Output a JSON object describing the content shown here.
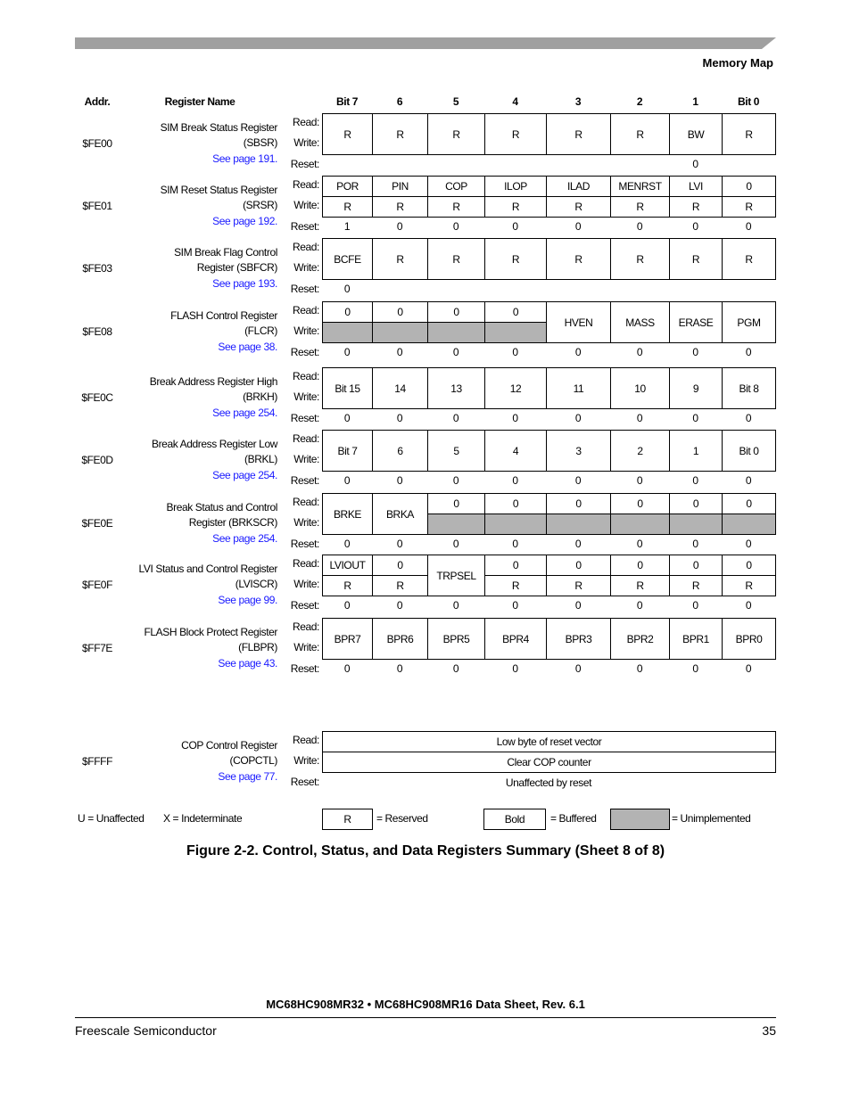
{
  "header": {
    "section": "Memory Map"
  },
  "columns": {
    "addr": "Addr.",
    "name": "Register Name",
    "bits": [
      "Bit 7",
      "6",
      "5",
      "4",
      "3",
      "2",
      "1",
      "Bit 0"
    ]
  },
  "row_labels": {
    "read": "Read:",
    "write": "Write:",
    "reset": "Reset:"
  },
  "registers": [
    {
      "addr": "$FE00",
      "name_lines": [
        "SIM Break Status Register",
        "(SBSR)"
      ],
      "link": "See page 191.",
      "cells": [
        {
          "t": "R",
          "c": [
            0,
            0
          ],
          "r": "rw"
        },
        {
          "t": "R",
          "c": [
            1,
            1
          ],
          "r": "rw"
        },
        {
          "t": "R",
          "c": [
            2,
            2
          ],
          "r": "rw"
        },
        {
          "t": "R",
          "c": [
            3,
            3
          ],
          "r": "rw"
        },
        {
          "t": "R",
          "c": [
            4,
            4
          ],
          "r": "rw"
        },
        {
          "t": "R",
          "c": [
            5,
            5
          ],
          "r": "rw"
        },
        {
          "t": "BW",
          "c": [
            6,
            6
          ],
          "r": "rw"
        },
        {
          "t": "R",
          "c": [
            7,
            7
          ],
          "r": "rw"
        }
      ],
      "reset": [
        "",
        "",
        "",
        "",
        "",
        "",
        "0",
        ""
      ]
    },
    {
      "addr": "$FE01",
      "name_lines": [
        "SIM Reset Status Register",
        "(SRSR)"
      ],
      "link": "See page 192.",
      "cells": [
        {
          "t": "POR",
          "c": [
            0,
            0
          ],
          "r": "r"
        },
        {
          "t": "PIN",
          "c": [
            1,
            1
          ],
          "r": "r"
        },
        {
          "t": "COP",
          "c": [
            2,
            2
          ],
          "r": "r"
        },
        {
          "t": "ILOP",
          "c": [
            3,
            3
          ],
          "r": "r"
        },
        {
          "t": "ILAD",
          "c": [
            4,
            4
          ],
          "r": "r"
        },
        {
          "t": "MENRST",
          "c": [
            5,
            5
          ],
          "r": "r"
        },
        {
          "t": "LVI",
          "c": [
            6,
            6
          ],
          "r": "r"
        },
        {
          "t": "0",
          "c": [
            7,
            7
          ],
          "r": "r"
        },
        {
          "t": "R",
          "c": [
            0,
            0
          ],
          "r": "w"
        },
        {
          "t": "R",
          "c": [
            1,
            1
          ],
          "r": "w"
        },
        {
          "t": "R",
          "c": [
            2,
            2
          ],
          "r": "w"
        },
        {
          "t": "R",
          "c": [
            3,
            3
          ],
          "r": "w"
        },
        {
          "t": "R",
          "c": [
            4,
            4
          ],
          "r": "w"
        },
        {
          "t": "R",
          "c": [
            5,
            5
          ],
          "r": "w"
        },
        {
          "t": "R",
          "c": [
            6,
            6
          ],
          "r": "w"
        },
        {
          "t": "R",
          "c": [
            7,
            7
          ],
          "r": "w"
        }
      ],
      "reset": [
        "1",
        "0",
        "0",
        "0",
        "0",
        "0",
        "0",
        "0"
      ]
    },
    {
      "addr": "$FE03",
      "name_lines": [
        "SIM Break Flag Control",
        "Register (SBFCR)"
      ],
      "link": "See page 193.",
      "cells": [
        {
          "t": "BCFE",
          "c": [
            0,
            0
          ],
          "r": "rw"
        },
        {
          "t": "R",
          "c": [
            1,
            1
          ],
          "r": "rw"
        },
        {
          "t": "R",
          "c": [
            2,
            2
          ],
          "r": "rw"
        },
        {
          "t": "R",
          "c": [
            3,
            3
          ],
          "r": "rw"
        },
        {
          "t": "R",
          "c": [
            4,
            4
          ],
          "r": "rw"
        },
        {
          "t": "R",
          "c": [
            5,
            5
          ],
          "r": "rw"
        },
        {
          "t": "R",
          "c": [
            6,
            6
          ],
          "r": "rw"
        },
        {
          "t": "R",
          "c": [
            7,
            7
          ],
          "r": "rw"
        }
      ],
      "reset": [
        "0",
        "",
        "",
        "",
        "",
        "",
        "",
        ""
      ]
    },
    {
      "addr": "$FE08",
      "name_lines": [
        "FLASH Control Register",
        "(FLCR)"
      ],
      "link": "See page 38.",
      "cells": [
        {
          "t": "0",
          "c": [
            0,
            0
          ],
          "r": "r"
        },
        {
          "t": "0",
          "c": [
            1,
            1
          ],
          "r": "r"
        },
        {
          "t": "0",
          "c": [
            2,
            2
          ],
          "r": "r"
        },
        {
          "t": "0",
          "c": [
            3,
            3
          ],
          "r": "r"
        },
        {
          "t": "",
          "c": [
            0,
            0
          ],
          "r": "w",
          "unimplemented": true
        },
        {
          "t": "",
          "c": [
            1,
            1
          ],
          "r": "w",
          "unimplemented": true
        },
        {
          "t": "",
          "c": [
            2,
            2
          ],
          "r": "w",
          "unimplemented": true
        },
        {
          "t": "",
          "c": [
            3,
            3
          ],
          "r": "w",
          "unimplemented": true
        },
        {
          "t": "HVEN",
          "c": [
            4,
            4
          ],
          "r": "rw"
        },
        {
          "t": "MASS",
          "c": [
            5,
            5
          ],
          "r": "rw"
        },
        {
          "t": "ERASE",
          "c": [
            6,
            6
          ],
          "r": "rw"
        },
        {
          "t": "PGM",
          "c": [
            7,
            7
          ],
          "r": "rw"
        }
      ],
      "reset": [
        "0",
        "0",
        "0",
        "0",
        "0",
        "0",
        "0",
        "0"
      ]
    },
    {
      "addr": "$FE0C",
      "name_lines": [
        "Break Address Register High",
        "(BRKH)"
      ],
      "link": "See page 254.",
      "cells": [
        {
          "t": "Bit 15",
          "c": [
            0,
            0
          ],
          "r": "rw"
        },
        {
          "t": "14",
          "c": [
            1,
            1
          ],
          "r": "rw"
        },
        {
          "t": "13",
          "c": [
            2,
            2
          ],
          "r": "rw"
        },
        {
          "t": "12",
          "c": [
            3,
            3
          ],
          "r": "rw"
        },
        {
          "t": "11",
          "c": [
            4,
            4
          ],
          "r": "rw"
        },
        {
          "t": "10",
          "c": [
            5,
            5
          ],
          "r": "rw"
        },
        {
          "t": "9",
          "c": [
            6,
            6
          ],
          "r": "rw"
        },
        {
          "t": "Bit 8",
          "c": [
            7,
            7
          ],
          "r": "rw"
        }
      ],
      "reset": [
        "0",
        "0",
        "0",
        "0",
        "0",
        "0",
        "0",
        "0"
      ]
    },
    {
      "addr": "$FE0D",
      "name_lines": [
        "Break Address Register Low",
        "(BRKL)"
      ],
      "link": "See page 254.",
      "cells": [
        {
          "t": "Bit 7",
          "c": [
            0,
            0
          ],
          "r": "rw"
        },
        {
          "t": "6",
          "c": [
            1,
            1
          ],
          "r": "rw"
        },
        {
          "t": "5",
          "c": [
            2,
            2
          ],
          "r": "rw"
        },
        {
          "t": "4",
          "c": [
            3,
            3
          ],
          "r": "rw"
        },
        {
          "t": "3",
          "c": [
            4,
            4
          ],
          "r": "rw"
        },
        {
          "t": "2",
          "c": [
            5,
            5
          ],
          "r": "rw"
        },
        {
          "t": "1",
          "c": [
            6,
            6
          ],
          "r": "rw"
        },
        {
          "t": "Bit 0",
          "c": [
            7,
            7
          ],
          "r": "rw"
        }
      ],
      "reset": [
        "0",
        "0",
        "0",
        "0",
        "0",
        "0",
        "0",
        "0"
      ]
    },
    {
      "addr": "$FE0E",
      "name_lines": [
        "Break Status and Control",
        "Register (BRKSCR)"
      ],
      "link": "See page 254.",
      "cells": [
        {
          "t": "BRKE",
          "c": [
            0,
            0
          ],
          "r": "rw"
        },
        {
          "t": "BRKA",
          "c": [
            1,
            1
          ],
          "r": "rw"
        },
        {
          "t": "0",
          "c": [
            2,
            2
          ],
          "r": "r"
        },
        {
          "t": "0",
          "c": [
            3,
            3
          ],
          "r": "r"
        },
        {
          "t": "0",
          "c": [
            4,
            4
          ],
          "r": "r"
        },
        {
          "t": "0",
          "c": [
            5,
            5
          ],
          "r": "r"
        },
        {
          "t": "0",
          "c": [
            6,
            6
          ],
          "r": "r"
        },
        {
          "t": "0",
          "c": [
            7,
            7
          ],
          "r": "r"
        },
        {
          "t": "",
          "c": [
            2,
            2
          ],
          "r": "w",
          "unimplemented": true
        },
        {
          "t": "",
          "c": [
            3,
            3
          ],
          "r": "w",
          "unimplemented": true
        },
        {
          "t": "",
          "c": [
            4,
            4
          ],
          "r": "w",
          "unimplemented": true
        },
        {
          "t": "",
          "c": [
            5,
            5
          ],
          "r": "w",
          "unimplemented": true
        },
        {
          "t": "",
          "c": [
            6,
            6
          ],
          "r": "w",
          "unimplemented": true
        },
        {
          "t": "",
          "c": [
            7,
            7
          ],
          "r": "w",
          "unimplemented": true
        }
      ],
      "reset": [
        "0",
        "0",
        "0",
        "0",
        "0",
        "0",
        "0",
        "0"
      ]
    },
    {
      "addr": "$FE0F",
      "name_lines": [
        "LVI Status and Control Register",
        "(LVISCR)"
      ],
      "link": "See page 99.",
      "cells": [
        {
          "t": "LVIOUT",
          "c": [
            0,
            0
          ],
          "r": "r"
        },
        {
          "t": "0",
          "c": [
            1,
            1
          ],
          "r": "r"
        },
        {
          "t": "R",
          "c": [
            0,
            0
          ],
          "r": "w"
        },
        {
          "t": "R",
          "c": [
            1,
            1
          ],
          "r": "w"
        },
        {
          "t": "TRPSEL",
          "c": [
            2,
            2
          ],
          "r": "rw"
        },
        {
          "t": "0",
          "c": [
            3,
            3
          ],
          "r": "r"
        },
        {
          "t": "0",
          "c": [
            4,
            4
          ],
          "r": "r"
        },
        {
          "t": "0",
          "c": [
            5,
            5
          ],
          "r": "r"
        },
        {
          "t": "0",
          "c": [
            6,
            6
          ],
          "r": "r"
        },
        {
          "t": "0",
          "c": [
            7,
            7
          ],
          "r": "r"
        },
        {
          "t": "R",
          "c": [
            3,
            3
          ],
          "r": "w"
        },
        {
          "t": "R",
          "c": [
            4,
            4
          ],
          "r": "w"
        },
        {
          "t": "R",
          "c": [
            5,
            5
          ],
          "r": "w"
        },
        {
          "t": "R",
          "c": [
            6,
            6
          ],
          "r": "w"
        },
        {
          "t": "R",
          "c": [
            7,
            7
          ],
          "r": "w"
        }
      ],
      "reset": [
        "0",
        "0",
        "0",
        "0",
        "0",
        "0",
        "0",
        "0"
      ]
    },
    {
      "addr": "$FF7E",
      "name_lines": [
        "FLASH Block Protect Register",
        "(FLBPR)"
      ],
      "link": "See page 43.",
      "cells": [
        {
          "t": "BPR7",
          "c": [
            0,
            0
          ],
          "r": "rw"
        },
        {
          "t": "BPR6",
          "c": [
            1,
            1
          ],
          "r": "rw"
        },
        {
          "t": "BPR5",
          "c": [
            2,
            2
          ],
          "r": "rw"
        },
        {
          "t": "BPR4",
          "c": [
            3,
            3
          ],
          "r": "rw"
        },
        {
          "t": "BPR3",
          "c": [
            4,
            4
          ],
          "r": "rw"
        },
        {
          "t": "BPR2",
          "c": [
            5,
            5
          ],
          "r": "rw"
        },
        {
          "t": "BPR1",
          "c": [
            6,
            6
          ],
          "r": "rw"
        },
        {
          "t": "BPR0",
          "c": [
            7,
            7
          ],
          "r": "rw"
        }
      ],
      "reset": [
        "0",
        "0",
        "0",
        "0",
        "0",
        "0",
        "0",
        "0"
      ]
    },
    {
      "addr": "$FFFF",
      "name_lines": [
        "COP Control Register",
        "(COPCTL)"
      ],
      "link": "See page 77.",
      "cells": [
        {
          "t": "Low byte of reset vector",
          "c": [
            0,
            7
          ],
          "r": "r"
        },
        {
          "t": "Clear COP counter",
          "c": [
            0,
            7
          ],
          "r": "w"
        }
      ],
      "reset_text": "Unaffected by reset"
    }
  ],
  "legend": {
    "unaffected": "U = Unaffected",
    "indeterminate": "X = Indeterminate",
    "reserved_box": "R",
    "reserved": "= Reserved",
    "bold_box": "Bold",
    "buffered": "= Buffered",
    "unimplemented": "= Unimplemented",
    "unimplemented_color": "#b3b3b3"
  },
  "caption": "Figure 2-2. Control, Status, and Data Registers Summary  (Sheet 8 of 8)",
  "footer": {
    "doc_title": "MC68HC908MR32 • MC68HC908MR16 Data Sheet, Rev. 6.1",
    "company": "Freescale Semiconductor",
    "page": "35"
  },
  "colors": {
    "link": "#1a1aff",
    "header_bar": "#a0a0a0"
  }
}
